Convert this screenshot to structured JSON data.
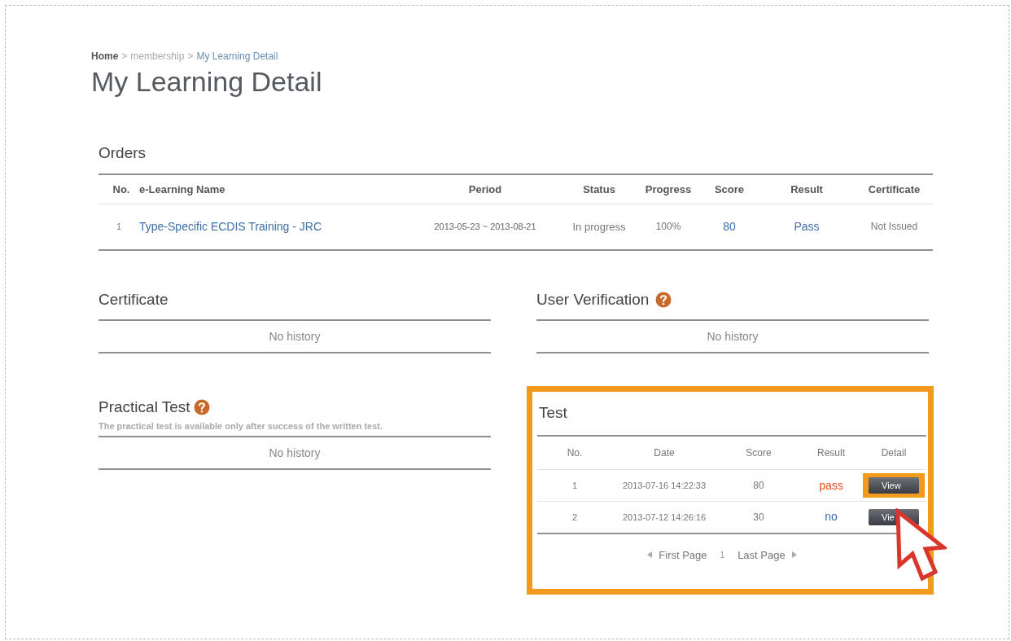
{
  "breadcrumb": [
    {
      "label": "Home",
      "current": false,
      "strong": true
    },
    {
      "label": "membership",
      "current": false,
      "strong": false
    },
    {
      "label": "My Learning Detail",
      "current": true,
      "strong": false
    }
  ],
  "breadcrumb_separator": ">",
  "page_title": "My Learning Detail",
  "orders": {
    "title": "Orders",
    "columns": [
      "No.",
      "e-Learning Name",
      "Period",
      "Status",
      "Progress",
      "Score",
      "Result",
      "Certificate"
    ],
    "rows": [
      {
        "no": "1",
        "name": "Type-Specific ECDIS Training - JRC",
        "period": "2013-05-23 ~ 2013-08-21",
        "status": "In progress",
        "progress": "100%",
        "score": "80",
        "result": "Pass",
        "certificate": "Not Issued"
      }
    ]
  },
  "certificate": {
    "title": "Certificate",
    "help": false,
    "empty": "No history"
  },
  "user_verification": {
    "title": "User Verification",
    "help": true,
    "empty": "No history"
  },
  "practical_test": {
    "title": "Practical Test",
    "help": true,
    "note": "The practical test is available only after success of the written test.",
    "empty": "No history"
  },
  "test": {
    "title": "Test",
    "highlighted": true,
    "columns": [
      "No.",
      "Date",
      "Score",
      "Result",
      "Detail"
    ],
    "rows": [
      {
        "no": "1",
        "date": "2013-07-16 14:22:33",
        "score": "80",
        "result": "pass",
        "color": "#e8501e",
        "button": "View",
        "highlighted": true
      },
      {
        "no": "2",
        "date": "2013-07-12 14:26:16",
        "score": "30",
        "result": "no",
        "color": "#3d6fa8",
        "button": "Vie",
        "highlighted": false
      }
    ],
    "pagination": {
      "first": "First Page",
      "pages": [
        "1"
      ],
      "last": "Last Page"
    }
  },
  "cursor": {
    "shown": true
  }
}
